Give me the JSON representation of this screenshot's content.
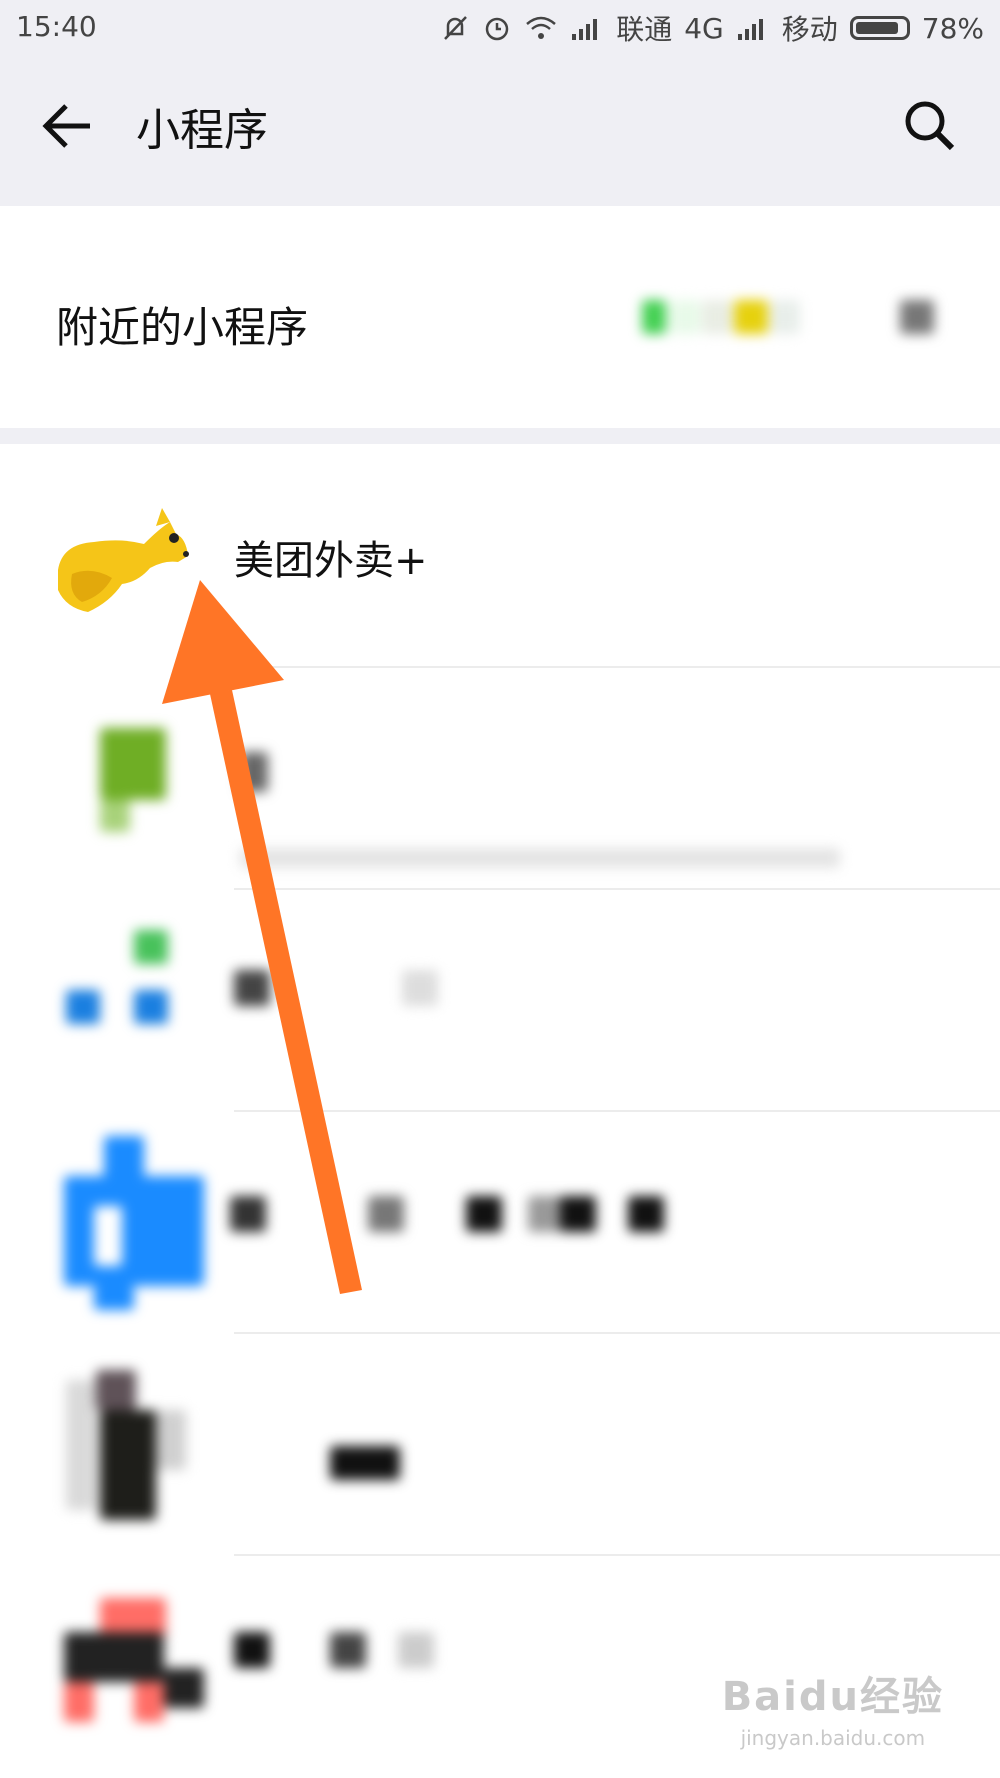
{
  "status_bar": {
    "time": "15:40",
    "carrier1": "联通",
    "network": "4G",
    "carrier2": "移动",
    "battery": "78%",
    "battery_level": 0.78,
    "icons": [
      "mute-icon",
      "alarm-icon",
      "wifi-icon",
      "signal-icon",
      "signal-icon",
      "battery-icon"
    ]
  },
  "nav": {
    "title": "小程序",
    "back_icon": "back-arrow-icon",
    "search_icon": "search-icon"
  },
  "nearby": {
    "label": "附近的小程序"
  },
  "list": {
    "items": [
      {
        "title": "美团外卖+",
        "icon": "meituan-kangaroo-icon"
      }
    ]
  },
  "annotation": {
    "arrow_color": "#ff7526"
  },
  "watermark": {
    "main": "Baidu经验",
    "sub": "jingyan.baidu.com"
  },
  "colors": {
    "header_bg": "#efeff4",
    "accent_orange": "#ff7526",
    "meituan_yellow": "#f5c518"
  }
}
